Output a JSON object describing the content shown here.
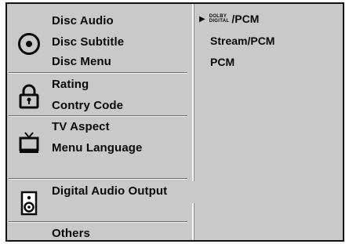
{
  "menu": {
    "items": [
      {
        "label": "Disc Audio"
      },
      {
        "label": "Disc Subtitle"
      },
      {
        "label": "Disc Menu"
      },
      {
        "label": "Rating"
      },
      {
        "label": "Contry Code"
      },
      {
        "label": "TV Aspect"
      },
      {
        "label": "Menu Language"
      },
      {
        "label": "Digital Audio Output"
      },
      {
        "label": "Others"
      }
    ],
    "selected": "Digital Audio Output",
    "icons": [
      "disc-icon",
      "lock-icon",
      "tv-icon",
      "speaker-icon"
    ]
  },
  "options": {
    "selected_marker": "▶",
    "items": [
      {
        "brand_top": "DOLBY",
        "brand_bottom": "DIGITAL",
        "label": "/PCM"
      },
      {
        "label": "Stream/PCM"
      },
      {
        "label": "PCM"
      }
    ]
  }
}
